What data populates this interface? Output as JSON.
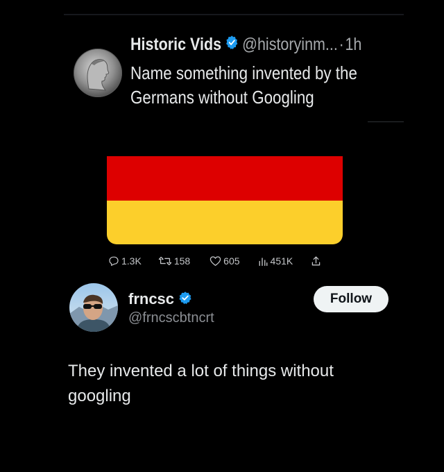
{
  "quoted_tweet": {
    "display_name": "Historic Vids",
    "handle": "@historyinm...",
    "separator": "·",
    "time": "1h",
    "text": "Name something invented by the Germans without Googling",
    "verified_icon": "verified-badge-icon",
    "flag_colors": [
      "#000000",
      "#dd0000",
      "#ffce00"
    ],
    "stats": {
      "replies": "1.3K",
      "retweets": "158",
      "likes": "605",
      "views": "451K"
    }
  },
  "reply": {
    "display_name": "frncsc",
    "handle": "@frncscbtncrt",
    "follow_label": "Follow",
    "text": "They invented a lot of things without googling",
    "verified_icon": "verified-badge-icon"
  },
  "colors": {
    "background": "#000000",
    "verified_blue": "#1d9bf0",
    "text_primary": "#e7e9ea",
    "text_secondary": "#8b8e93"
  }
}
